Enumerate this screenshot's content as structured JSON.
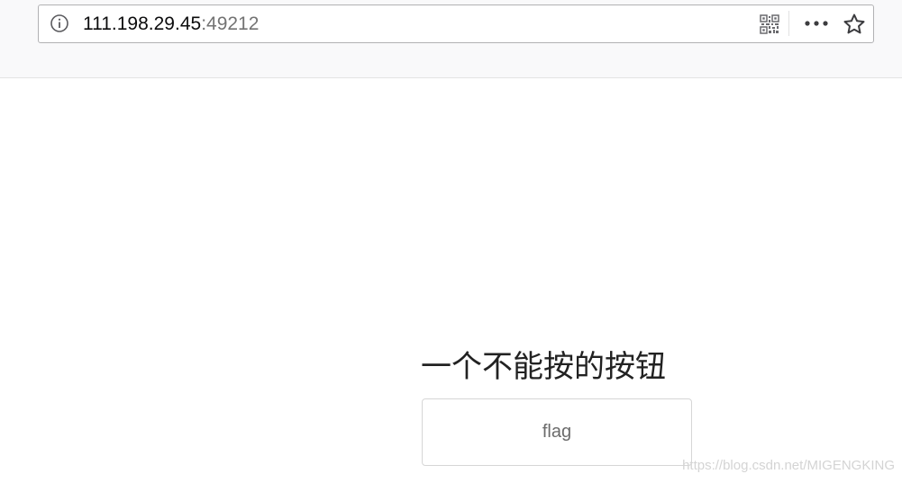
{
  "browser": {
    "url_host": "111.198.29.45",
    "url_port": ":49212",
    "icons": {
      "info": "info-icon",
      "qr": "qr-code-icon",
      "more": "more-options-icon",
      "bookmark": "star-icon"
    }
  },
  "page": {
    "heading": "一个不能按的按钮",
    "button_label": "flag",
    "button_disabled": true
  },
  "watermark": "https://blog.csdn.net/MIGENGKING",
  "colors": {
    "toolbar_bg": "#f9f9fa",
    "url_host": "#0c0c0d",
    "url_port": "#737373",
    "heading": "#222222",
    "button_text": "#6b6b6b",
    "button_border": "#d6d6d6"
  }
}
